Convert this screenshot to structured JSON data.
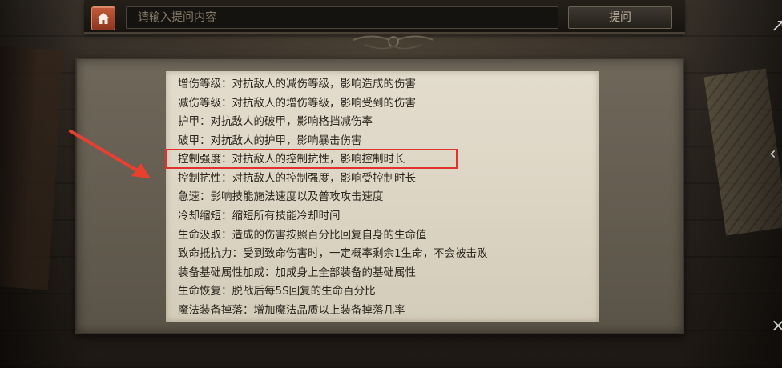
{
  "search": {
    "placeholder": "请输入提问内容",
    "value": ""
  },
  "ask_button": {
    "label": "提问"
  },
  "colors": {
    "accent_home": "#b34a2d",
    "highlight": "#e0332e",
    "panel_bg": "#ddd5c4"
  },
  "icons": {
    "home": "home-icon",
    "arrow": "red-arrow-annotation"
  },
  "attributes": [
    "增伤等级：对抗敌人的减伤等级，影响造成的伤害",
    "减伤等级：对抗敌人的增伤等级，影响受到的伤害",
    "护甲：对抗敌人的破甲，影响格挡减伤率",
    "破甲：对抗敌人的护甲，影响暴击伤害",
    "控制强度：对抗敌人的控制抗性，影响控制时长",
    "控制抗性：对抗敌人的控制强度，影响受控制时长",
    "急速：影响技能施法速度以及普攻攻击速度",
    "冷却缩短：缩短所有技能冷却时间",
    "生命汲取：造成的伤害按照百分比回复自身的生命值",
    "致命抵抗力：受到致命伤害时，一定概率剩余1生命，不会被击败",
    "装备基础属性加成：加成身上全部装备的基础属性",
    "生命恢复：脱战后每5S回复的生命百分比",
    "魔法装备掉落：增加魔法品质以上装备掉落几率"
  ],
  "highlighted_index": 4
}
